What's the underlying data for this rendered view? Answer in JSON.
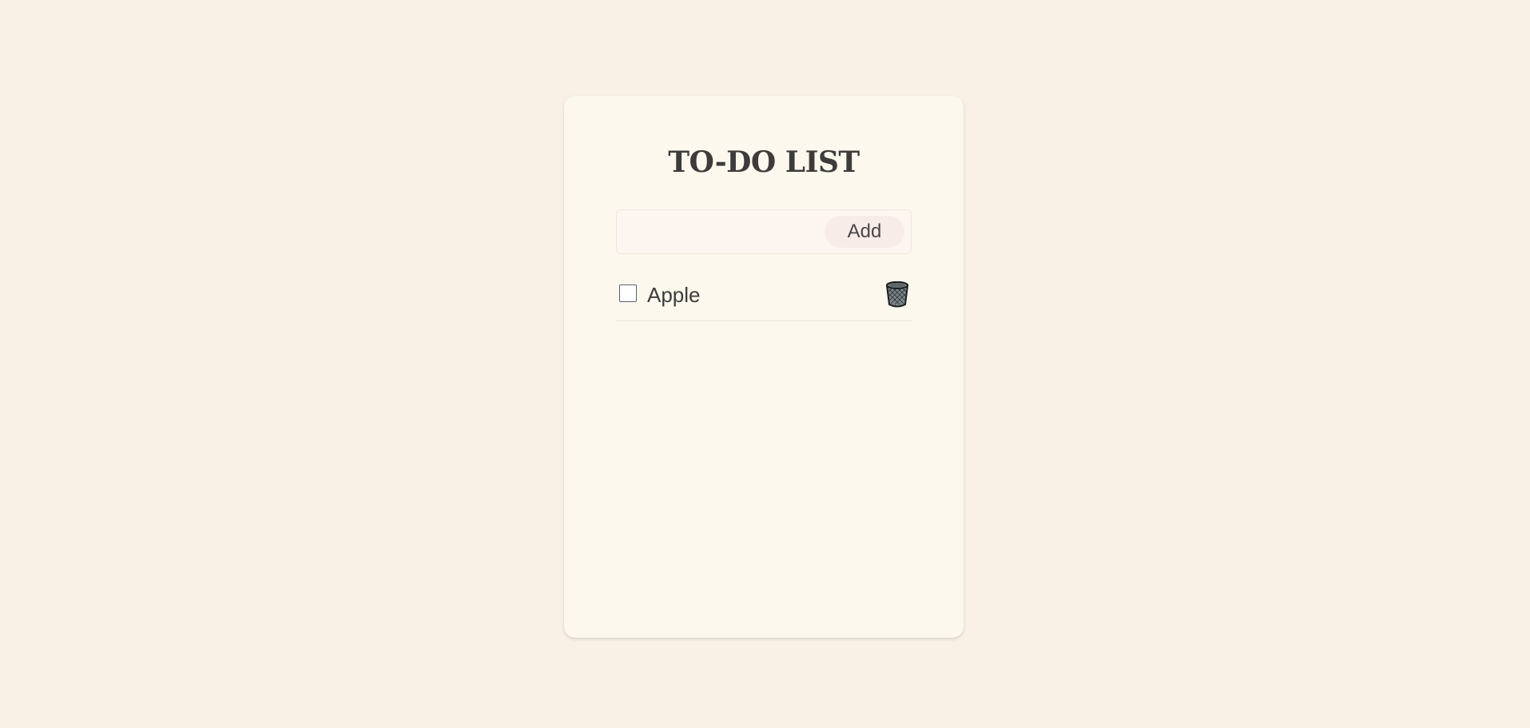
{
  "app": {
    "title": "TO-DO LIST"
  },
  "form": {
    "input_value": "",
    "input_placeholder": "",
    "add_label": "Add"
  },
  "tasks": [
    {
      "label": "Apple",
      "completed": false
    }
  ],
  "icons": {
    "delete": "trash-icon"
  },
  "colors": {
    "page_background": "#f9f1e6",
    "card_background": "#fcf8ee",
    "input_background": "#fdf6f0",
    "button_background": "#f8ece8",
    "text": "#3e3b3b"
  }
}
